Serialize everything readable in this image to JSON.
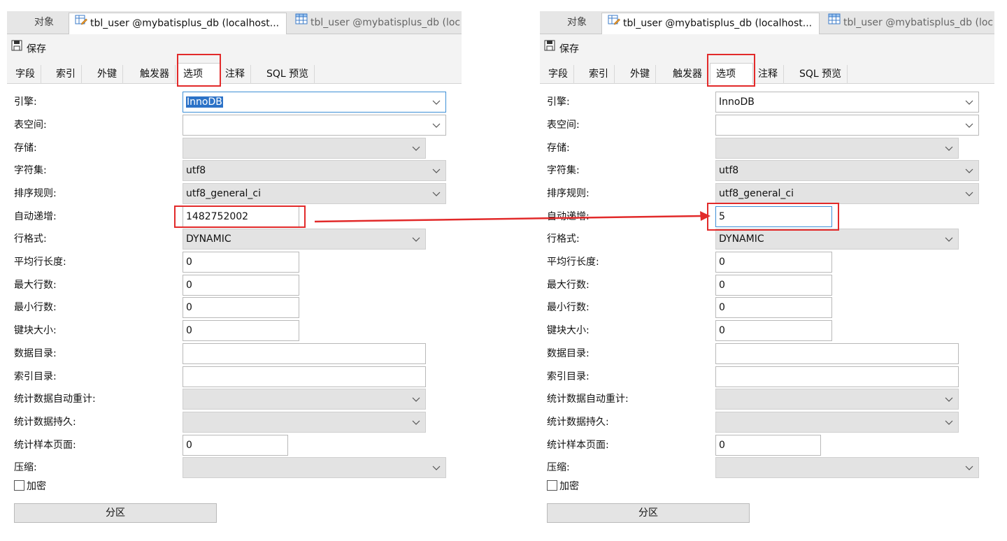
{
  "panels": [
    {
      "window_tabs": {
        "objects": "对象",
        "active": "tbl_user @mybatisplus_db (localhost...",
        "inactive": "tbl_user @mybatisplus_db (loc"
      },
      "toolbar": {
        "save_label": "保存"
      },
      "subtabs": [
        "字段",
        "索引",
        "外键",
        "触发器",
        "选项",
        "注释",
        "SQL 预览"
      ],
      "active_subtab": "选项",
      "fields": {
        "engine": {
          "label": "引擎:",
          "value": "InnoDB"
        },
        "tablespace": {
          "label": "表空间:",
          "value": ""
        },
        "storage": {
          "label": "存储:",
          "value": ""
        },
        "charset": {
          "label": "字符集:",
          "value": "utf8"
        },
        "collation": {
          "label": "排序规则:",
          "value": "utf8_general_ci"
        },
        "auto_increment": {
          "label": "自动递增:",
          "value": "1482752002"
        },
        "row_format": {
          "label": "行格式:",
          "value": "DYNAMIC"
        },
        "avg_row_length": {
          "label": "平均行长度:",
          "value": "0"
        },
        "max_rows": {
          "label": "最大行数:",
          "value": "0"
        },
        "min_rows": {
          "label": "最小行数:",
          "value": "0"
        },
        "key_block_size": {
          "label": "键块大小:",
          "value": "0"
        },
        "data_directory": {
          "label": "数据目录:",
          "value": ""
        },
        "index_directory": {
          "label": "索引目录:",
          "value": ""
        },
        "stats_auto_recalc": {
          "label": "统计数据自动重计:",
          "value": ""
        },
        "stats_persistent": {
          "label": "统计数据持久:",
          "value": ""
        },
        "stats_sample_pages": {
          "label": "统计样本页面:",
          "value": "0"
        },
        "compression": {
          "label": "压缩:",
          "value": ""
        }
      },
      "encryption_label": "加密",
      "partition_button": "分区"
    },
    {
      "window_tabs": {
        "objects": "对象",
        "active": "tbl_user @mybatisplus_db (localhost...",
        "inactive": "tbl_user @mybatisplus_db (loc"
      },
      "toolbar": {
        "save_label": "保存"
      },
      "subtabs": [
        "字段",
        "索引",
        "外键",
        "触发器",
        "选项",
        "注释",
        "SQL 预览"
      ],
      "active_subtab": "选项",
      "fields": {
        "engine": {
          "label": "引擎:",
          "value": "InnoDB"
        },
        "tablespace": {
          "label": "表空间:",
          "value": ""
        },
        "storage": {
          "label": "存储:",
          "value": ""
        },
        "charset": {
          "label": "字符集:",
          "value": "utf8"
        },
        "collation": {
          "label": "排序规则:",
          "value": "utf8_general_ci"
        },
        "auto_increment": {
          "label": "自动递增:",
          "value": "5"
        },
        "row_format": {
          "label": "行格式:",
          "value": "DYNAMIC"
        },
        "avg_row_length": {
          "label": "平均行长度:",
          "value": "0"
        },
        "max_rows": {
          "label": "最大行数:",
          "value": "0"
        },
        "min_rows": {
          "label": "最小行数:",
          "value": "0"
        },
        "key_block_size": {
          "label": "键块大小:",
          "value": "0"
        },
        "data_directory": {
          "label": "数据目录:",
          "value": ""
        },
        "index_directory": {
          "label": "索引目录:",
          "value": ""
        },
        "stats_auto_recalc": {
          "label": "统计数据自动重计:",
          "value": ""
        },
        "stats_persistent": {
          "label": "统计数据持久:",
          "value": ""
        },
        "stats_sample_pages": {
          "label": "统计样本页面:",
          "value": "0"
        },
        "compression": {
          "label": "压缩:",
          "value": ""
        }
      },
      "encryption_label": "加密",
      "partition_button": "分区"
    }
  ],
  "annotation_color": "#e22a2a",
  "selection_color": "#2c72c7"
}
